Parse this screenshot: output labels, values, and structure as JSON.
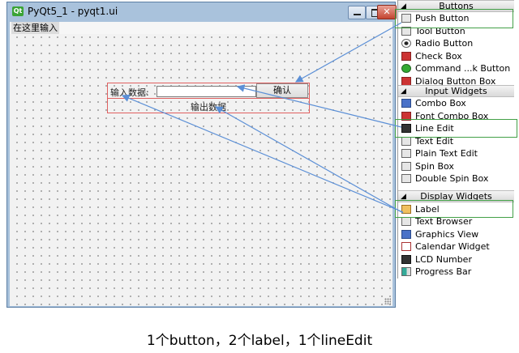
{
  "window": {
    "logo_text": "Qt",
    "title": "PyQt5_1 - pyqt1.ui",
    "close_symbol": "✕"
  },
  "form": {
    "menu_placeholder": "在这里输入",
    "input_label": "输入数据:",
    "line_edit_value": "",
    "button_label": "确认",
    "output_label": "输出数据"
  },
  "widget_box": {
    "categories": [
      {
        "name": "Buttons",
        "items": [
          "Push Button",
          "Tool Button",
          "Radio Button",
          "Check Box",
          "Command ...k Button",
          "Dialog Button Box"
        ]
      },
      {
        "name": "Input Widgets",
        "items": [
          "Combo Box",
          "Font Combo Box",
          "Line Edit",
          "Text Edit",
          "Plain Text Edit",
          "Spin Box",
          "Double Spin Box"
        ]
      },
      {
        "name": "Display Widgets",
        "items": [
          "Label",
          "Text Browser",
          "Graphics View",
          "Calendar Widget",
          "LCD Number",
          "Progress Bar"
        ]
      }
    ],
    "highlighted": [
      "Push Button",
      "Line Edit",
      "Label"
    ]
  },
  "colors": {
    "highlight_box": "#43a047",
    "arrow": "#5b8fd6",
    "form_border": "#e06060"
  },
  "caption": "1个button，2个label，1个lineEdit"
}
